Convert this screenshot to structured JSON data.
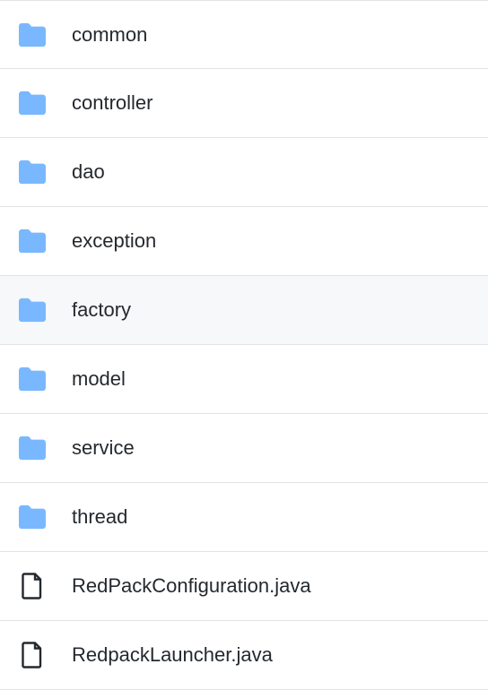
{
  "files": [
    {
      "type": "folder",
      "name": "common",
      "hovered": false
    },
    {
      "type": "folder",
      "name": "controller",
      "hovered": false
    },
    {
      "type": "folder",
      "name": "dao",
      "hovered": false
    },
    {
      "type": "folder",
      "name": "exception",
      "hovered": false
    },
    {
      "type": "folder",
      "name": "factory",
      "hovered": true
    },
    {
      "type": "folder",
      "name": "model",
      "hovered": false
    },
    {
      "type": "folder",
      "name": "service",
      "hovered": false
    },
    {
      "type": "folder",
      "name": "thread",
      "hovered": false
    },
    {
      "type": "file",
      "name": "RedPackConfiguration.java",
      "hovered": false
    },
    {
      "type": "file",
      "name": "RedpackLauncher.java",
      "hovered": false
    }
  ]
}
